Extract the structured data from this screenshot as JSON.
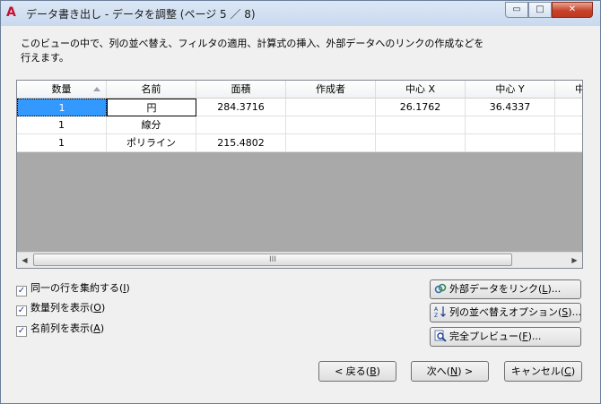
{
  "window": {
    "title": "データ書き出し - データを調整 (ページ 5 ／ 8)",
    "app_icon_letter": "A",
    "minimize": "▭",
    "maximize": "□",
    "close": "✕"
  },
  "description": "このビューの中で、列の並べ替え、フィルタの適用、計算式の挿入、外部データへのリンクの作成などを行えます。",
  "table": {
    "columns": [
      "数量",
      "名前",
      "面積",
      "作成者",
      "中心 X",
      "中心 Y",
      "中"
    ],
    "rows": [
      [
        "1",
        "円",
        "284.3716",
        "",
        "26.1762",
        "36.4337",
        ""
      ],
      [
        "1",
        "線分",
        "",
        "",
        "",
        "",
        ""
      ],
      [
        "1",
        "ポリライン",
        "215.4802",
        "",
        "",
        "",
        ""
      ]
    ],
    "scroll_left": "◀",
    "scroll_right": "▶",
    "scroll_thumb_grip": "III"
  },
  "options": {
    "combine_rows": {
      "label": "同一の行を集約する(",
      "key": "I",
      "end": ")",
      "checked": true
    },
    "show_count": {
      "label": "数量列を表示(",
      "key": "O",
      "end": ")",
      "checked": true
    },
    "show_name": {
      "label": "名前列を表示(",
      "key": "A",
      "end": ")",
      "checked": true
    }
  },
  "buttons": {
    "link_external": {
      "label": "外部データをリンク(",
      "key": "L",
      "end": ")...",
      "icon": "link-icon"
    },
    "sort_options": {
      "label": "列の並べ替えオプション(",
      "key": "S",
      "end": ")...",
      "icon": "sort-az-icon"
    },
    "full_preview": {
      "label": "完全プレビュー(",
      "key": "F",
      "end": ")...",
      "icon": "preview-magnifier-icon"
    },
    "back": {
      "label": "< 戻る(",
      "key": "B",
      "end": ")"
    },
    "next": {
      "label": "次へ(",
      "key": "N",
      "end": ") >"
    },
    "cancel": {
      "label": "キャンセル(",
      "key": "C",
      "end": ")"
    }
  },
  "colors": {
    "selection": "#3399ff",
    "grid_empty": "#a9a9a9",
    "title_gradient": "#dbe7f5"
  }
}
